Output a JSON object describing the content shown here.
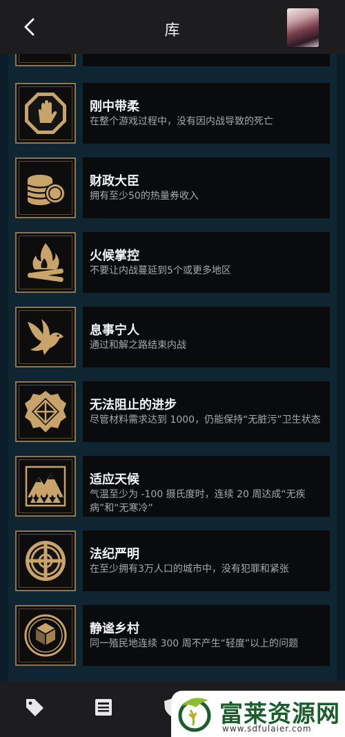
{
  "header": {
    "title": "库",
    "back_icon": "chevron-left-icon",
    "avatar_icon": "user-avatar"
  },
  "achievements": [
    {
      "icon": "hand-octagon-icon",
      "name": "刚中带柔",
      "desc": "在整个游戏过程中，没有因内战导致的死亡"
    },
    {
      "icon": "coins-icon",
      "name": "财政大臣",
      "desc": "拥有至少50的热量券收入"
    },
    {
      "icon": "campfire-icon",
      "name": "火候掌控",
      "desc": "不要让内战蔓延到5个或更多地区"
    },
    {
      "icon": "dove-icon",
      "name": "息事宁人",
      "desc": "通过和解之路结束内战"
    },
    {
      "icon": "gear-emblem-icon",
      "name": "无法阻止的进步",
      "desc": "尽管材料需求达到 1000，仍能保持“无脏污”卫生状态"
    },
    {
      "icon": "mountain-icon",
      "name": "适应天候",
      "desc": "气温至少为 -100 摄氏度时，连续 20 周达成“无疾病”和“无寒冷”"
    },
    {
      "icon": "crosshair-circle-icon",
      "name": "法纪严明",
      "desc": "在至少拥有3万人口的城市中，没有犯罪和紧张"
    },
    {
      "icon": "hex-blocks-icon",
      "name": "静谧乡村",
      "desc": "同一殖民地连续 300 周不产生“轻度”以上的问题"
    }
  ],
  "bottom_nav": [
    "tag-icon",
    "news-icon",
    "shield-icon"
  ],
  "watermark": {
    "logo_icon": "leaf-logo-icon",
    "title": "富莱资源网",
    "url": "www.sdfulaier.com"
  },
  "colors": {
    "background": "#0b1d28",
    "gold": "#c9a46a",
    "bar": "#1d1d1f",
    "card": "#0a0b0d",
    "watermark_green": "#1b5e2c"
  }
}
